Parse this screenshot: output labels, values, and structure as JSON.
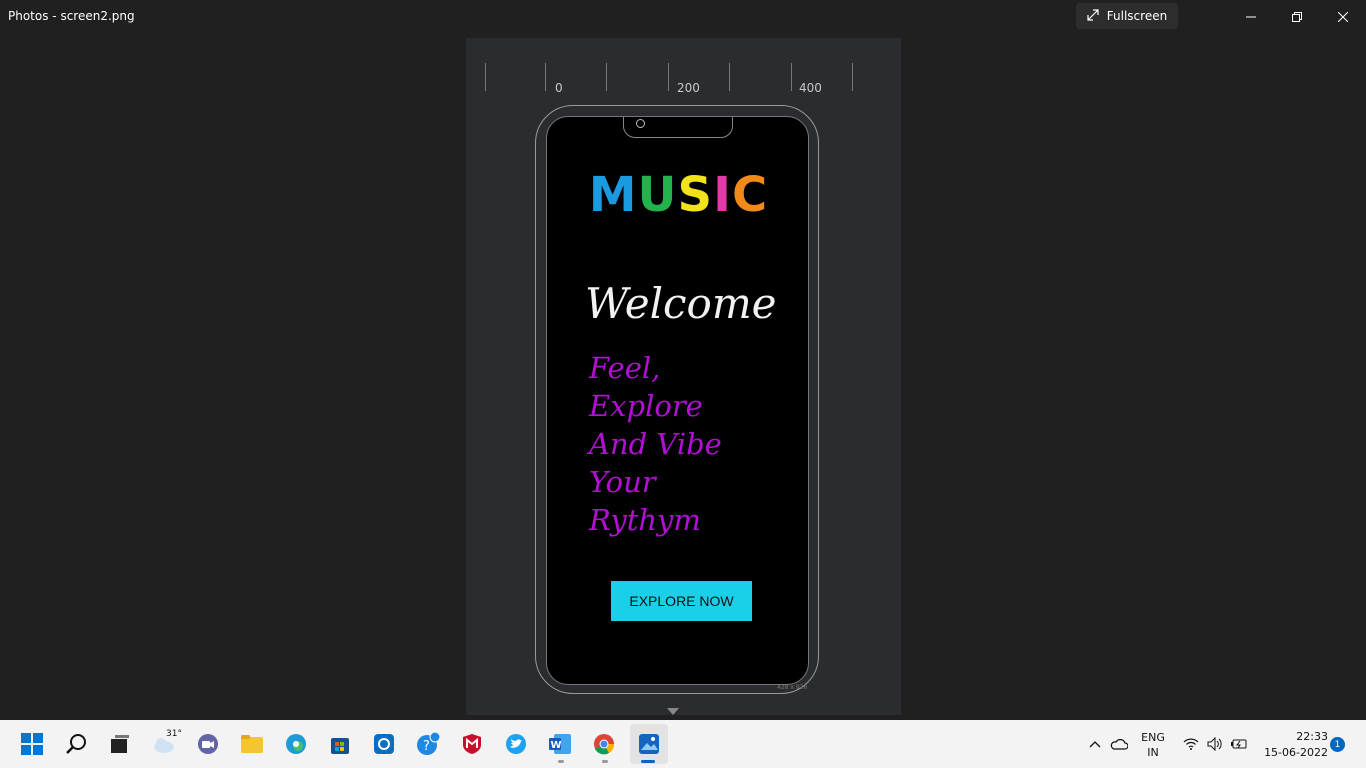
{
  "window": {
    "title": "Photos - screen2.png",
    "fullscreen_label": "Fullscreen"
  },
  "ruler": {
    "labels": [
      "0",
      "200",
      "400"
    ]
  },
  "phone_app": {
    "logo_letters": [
      "M",
      "U",
      "S",
      "I",
      "C"
    ],
    "logo_colors": [
      "#1a9be0",
      "#22b34c",
      "#f2e21a",
      "#e23aa8",
      "#f28a1a"
    ],
    "welcome": "Welcome",
    "tagline_lines": [
      "Feel,",
      "Explore",
      "And Vibe",
      "Your",
      "Rythym"
    ],
    "button_label": "EXPLORE NOW",
    "button_color": "#1ad0e8",
    "tagline_color": "#b10fd4"
  },
  "image_dims": "428 x 926",
  "taskbar": {
    "weather_temp": "31°",
    "language": [
      "ENG",
      "IN"
    ],
    "time": "22:33",
    "date": "15-06-2022",
    "notification_count": "1"
  }
}
